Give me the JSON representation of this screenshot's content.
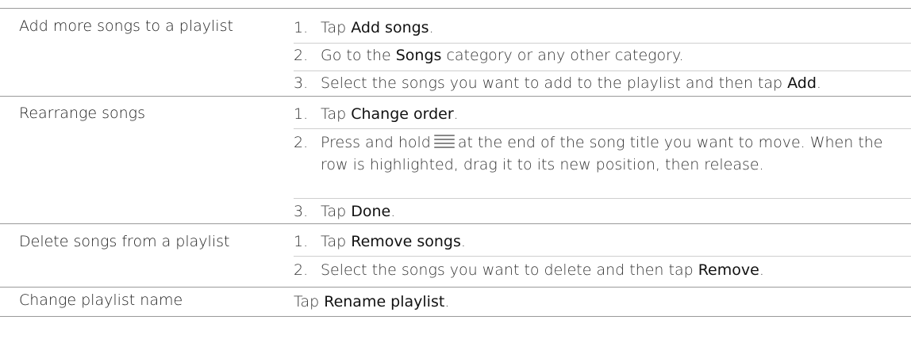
{
  "rows": [
    {
      "task": "Add more songs to a playlist",
      "steps": [
        {
          "num": "1.",
          "pre": "Tap ",
          "bold": "Add songs",
          "post": "."
        },
        {
          "num": "2.",
          "pre": "Go to the ",
          "bold": "Songs",
          "post": " category or any other category."
        },
        {
          "num": "3.",
          "pre": "Select the songs you want to add to the playlist and then tap ",
          "bold": "Add",
          "post": "."
        }
      ]
    },
    {
      "task": "Rearrange songs",
      "steps": [
        {
          "num": "1.",
          "pre": "Tap ",
          "bold": "Change order",
          "post": "."
        },
        {
          "num": "2.",
          "pre": "Press and hold",
          "icon": "drag-handle-icon",
          "post": "at the end of the song title you want to move. When the row is highlighted, drag it to its new position, then release."
        },
        {
          "num": "3.",
          "pre": "Tap ",
          "bold": "Done",
          "post": "."
        }
      ]
    },
    {
      "task": "Delete songs from a playlist",
      "steps": [
        {
          "num": "1.",
          "pre": "Tap ",
          "bold": "Remove songs",
          "post": "."
        },
        {
          "num": "2.",
          "pre": "Select the songs you want to delete and then tap ",
          "bold": "Remove",
          "post": "."
        }
      ]
    },
    {
      "task": "Change playlist name",
      "plain": {
        "pre": "Tap ",
        "bold": "Rename playlist",
        "post": "."
      }
    }
  ]
}
